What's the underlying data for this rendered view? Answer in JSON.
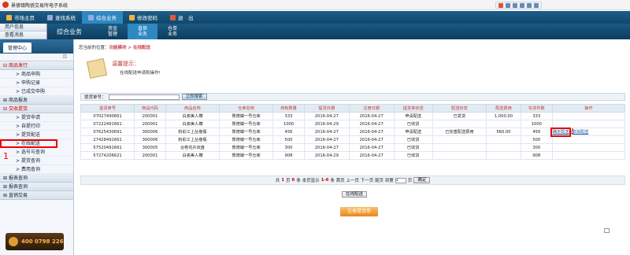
{
  "window_title": "景德镇陶瓷交易所电子系统",
  "top_nav": [
    "市场主页",
    "查找系统",
    "综合业务",
    "修改密码",
    "退　出"
  ],
  "top_nav_colors": [
    "#f4b43a",
    "#9ad",
    "#9ad",
    "#f4b43a",
    "#e05a3a"
  ],
  "user_panel": [
    "用户信息",
    "查看消息"
  ],
  "section_title": "综合业务",
  "sub_tabs": [
    "资金\n管理",
    "直供\n业务",
    "仓单\n业务"
  ],
  "sidebar": {
    "header": "管理中心",
    "groups": [
      {
        "label": "商品发行",
        "items": [
          "商品申购",
          "申购记录",
          "已成交申购"
        ]
      },
      {
        "label": "商品报发",
        "items": []
      },
      {
        "label": "交收提货",
        "items": [
          "提货申请",
          "自提打印",
          "提货配送",
          "在线配送",
          "选号与查询",
          "提货查询",
          "费用查询"
        ]
      },
      {
        "label": "报表查询",
        "items": []
      },
      {
        "label": "报表查询",
        "items": []
      },
      {
        "label": "直销交易",
        "items": []
      }
    ],
    "phone": "400 0798 226"
  },
  "annotations": {
    "one": "1",
    "two": "2"
  },
  "breadcrumb": {
    "prefix": "您当前的位置：",
    "path": "功能模块 > 在线配送"
  },
  "tip": {
    "title": "温馨提示：",
    "text": "在线配送申请和操作!"
  },
  "filter": {
    "label": "提货单号：",
    "value": "",
    "button": "立即搜索"
  },
  "table": {
    "headers": [
      "提货单号",
      "商品代码",
      "商品名称",
      "仓库名称",
      "持有数量",
      "提货日期",
      "注册日期",
      "提货单状态",
      "配送状态",
      "配送费用",
      "实货件数",
      "操作"
    ],
    "rows": [
      [
        "07027490661",
        "200001",
        "白瓷美人樽",
        "景德镇一号仓库",
        "333",
        "2016-04-27",
        "2016-04-27",
        "申请配送",
        "已发货",
        "1,000.00",
        "333",
        ""
      ],
      [
        "07222491661",
        "200001",
        "白瓷美人樽",
        "景德镇一号仓库",
        "1000",
        "2016-04-29",
        "2016-04-27",
        "已收货",
        "",
        "",
        "1000",
        ""
      ],
      [
        "07625430691",
        "300006",
        "粉彩江上丛巷瓶",
        "景德镇一号仓库",
        "456",
        "2016-04-27",
        "2016-04-27",
        "申请配送",
        "已完善配送费用",
        "560.00",
        "456",
        ""
      ],
      [
        "27428491661",
        "300006",
        "粉彩江上丛巷瓶",
        "景德镇一号仓库",
        "500",
        "2016-04-27",
        "2016-04-27",
        "已收货",
        "",
        "",
        "500",
        ""
      ],
      [
        "57520491661",
        "300005",
        "合卷花卉双盘",
        "景德镇一号仓库",
        "300",
        "2016-04-27",
        "2016-04-27",
        "已收货",
        "",
        "",
        "300",
        ""
      ],
      [
        "57274206621",
        "200001",
        "白瓷美人樽",
        "景德镇一号仓库",
        "908",
        "2016-04-29",
        "2016-04-27",
        "已收货",
        "",
        "",
        "908",
        ""
      ]
    ],
    "row3_actions": [
      "确定配送",
      "取消配送"
    ]
  },
  "pager": {
    "text1": "共",
    "total": "1",
    "text2": "页",
    "count": "6",
    "text3": "条 本页显示",
    "range": "1-6",
    "text4": "条 首页 上一页 下一页 尾页 到第",
    "page_value": "1",
    "text5": "页",
    "go": "确定"
  },
  "submit_button": "在线配送",
  "big_button": "注册提货单"
}
